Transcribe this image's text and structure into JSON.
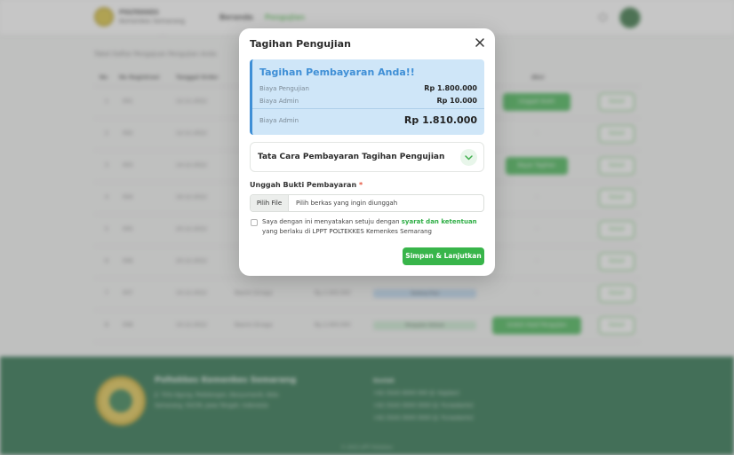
{
  "header": {
    "brand_line1": "POLTEKKES",
    "brand_line2": "Kemenkes Semarang",
    "nav": [
      "Beranda",
      "Pengujian"
    ]
  },
  "background": {
    "breadcrumb": "· ·",
    "subtitle": "Tabel Daftar Pengajuan Pengujian Anda",
    "columns": [
      "No",
      "No Registrasi",
      "Tanggal Order",
      "",
      "Aksi"
    ],
    "rows": [
      {
        "no": "1",
        "reg": "001",
        "date": "12-11-2022",
        "col4": "",
        "status": "",
        "button": "Unggah Bukti",
        "action": "Detail"
      },
      {
        "no": "2",
        "reg": "002",
        "date": "12-11-2022",
        "col4": "",
        "status": "",
        "button": "-",
        "action": "Detail"
      },
      {
        "no": "3",
        "reg": "003",
        "date": "14-12-2022",
        "col4": "",
        "status": "",
        "button": "Bayar Tagihan",
        "action": "Detail"
      },
      {
        "no": "4",
        "reg": "004",
        "date": "16-12-2022",
        "col4": "",
        "status": "",
        "button": "-",
        "action": "Detail"
      },
      {
        "no": "5",
        "reg": "005",
        "date": "20-12-2022",
        "col4": "",
        "status": "",
        "button": "-",
        "action": "Detail"
      },
      {
        "no": "6",
        "reg": "006",
        "date": "20-12-2022",
        "col4": "",
        "status": "",
        "button": "-",
        "action": "Detail"
      },
      {
        "no": "7",
        "reg": "007",
        "date": "10-12-2022",
        "col4": "Naomi Ginaga",
        "amount": "Rp 2.000.000",
        "status": "Sedang Diuji",
        "button": "-",
        "action": "Detail"
      },
      {
        "no": "8",
        "reg": "008",
        "date": "10-12-2022",
        "col4": "Naomi Ginaga",
        "amount": "Rp 2.000.000",
        "status": "Pengujian Selesai",
        "button": "Unduh Hasil Pengujian",
        "action": "Detail"
      }
    ]
  },
  "footer": {
    "title": "Poltekkes Kemenkes Semarang",
    "address_line1": "Jl. Tirto Agung, Pedalangan, Banyumanik, Kota",
    "address_line2": "Semarang, 50239, Jawa Tengah, Indonesia",
    "contact_label": "Kontak",
    "phones": [
      "+62 (024) 6000 000 (Jl. Kajalan)",
      "+62 (024) 0000 0000 (Jl. Purwokerto)",
      "+62 (024) 0000 0000 (Jl. Purwokerto)"
    ],
    "copyright": "© 2023 LPPT Poltekkes"
  },
  "modal": {
    "title": "Tagihan Pengujian",
    "close_icon": "close-icon",
    "bill": {
      "heading": "Tagihan Pembayaran Anda!!",
      "items": [
        {
          "label": "Biaya Pengujian",
          "value": "Rp 1.800.000"
        },
        {
          "label": "Biaya Admin",
          "value": "Rp 10.000"
        }
      ],
      "total_label": "Biaya Admin",
      "total_value": "Rp 1.810.000"
    },
    "accordion_label": "Tata Cara Pembayaran Tagihan Pengujian",
    "upload": {
      "label": "Unggah Bukti Pembayaran",
      "required_mark": "*",
      "button": "Pilih File",
      "placeholder": "Pilih berkas yang ingin diunggah"
    },
    "terms": {
      "prefix": "Saya dengan ini menyatakan setuju dengan ",
      "link": "syarat dan ketentuan",
      "line2": "yang berlaku di LPPT POLTEKKES Kemenkes Semarang"
    },
    "submit": "Simpan & Lanjutkan"
  },
  "colors": {
    "primary_green": "#38b54a",
    "info_blue": "#3f8fd6",
    "footer_green": "#1e6a42"
  }
}
